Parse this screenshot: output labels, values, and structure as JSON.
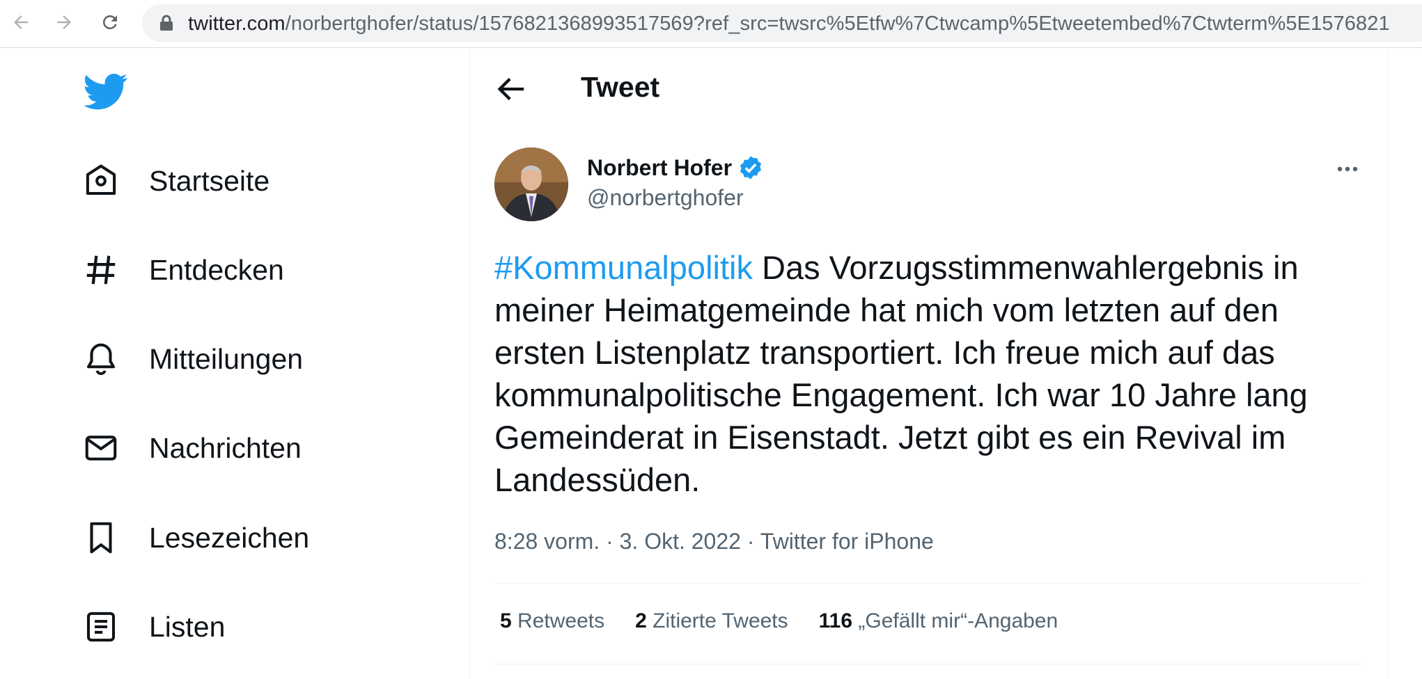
{
  "browser": {
    "url_host": "twitter.com",
    "url_path": "/norbertghofer/status/1576821368993517569?ref_src=twsrc%5Etfw%7Ctwcamp%5Etweetembed%7Ctwterm%5E1576821"
  },
  "sidebar": {
    "items": [
      {
        "label": "Startseite",
        "icon": "home-icon"
      },
      {
        "label": "Entdecken",
        "icon": "hashtag-icon"
      },
      {
        "label": "Mitteilungen",
        "icon": "bell-icon"
      },
      {
        "label": "Nachrichten",
        "icon": "mail-icon"
      },
      {
        "label": "Lesezeichen",
        "icon": "bookmark-icon"
      },
      {
        "label": "Listen",
        "icon": "list-icon"
      }
    ]
  },
  "header": {
    "title": "Tweet"
  },
  "tweet": {
    "author_name": "Norbert Hofer",
    "handle": "@norbertghofer",
    "hashtag": "#Kommunalpolitik",
    "text": " Das Vorzugsstimmenwahlergebnis in meiner Heimatgemeinde hat mich vom letzten auf den ersten Listenplatz transportiert. Ich freue mich auf das kommunalpolitische Engagement. Ich war 10 Jahre lang Gemeinderat in Eisenstadt. Jetzt gibt es ein Revival im Landessüden.",
    "meta": "8:28 vorm. · 3. Okt. 2022 · Twitter for iPhone"
  },
  "stats": [
    {
      "count": "5",
      "label": "Retweets"
    },
    {
      "count": "2",
      "label": "Zitierte Tweets"
    },
    {
      "count": "116",
      "label": "„Gefällt mir“-Angaben"
    }
  ],
  "colors": {
    "accent": "#1d9bf0",
    "secondary_text": "#536471",
    "primary_text": "#0f1419"
  }
}
